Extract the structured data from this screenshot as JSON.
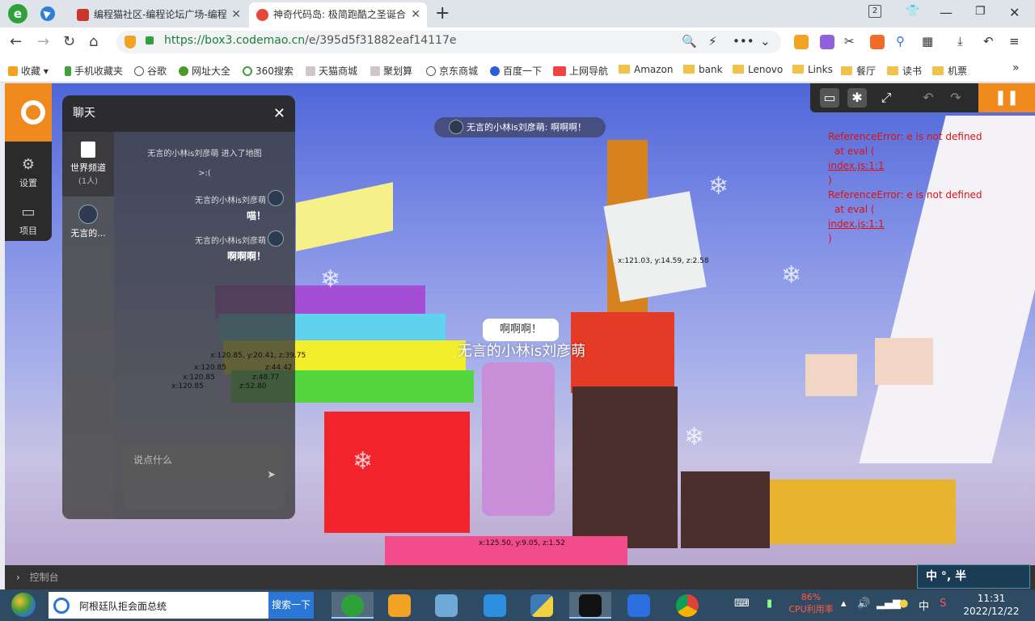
{
  "browser": {
    "brand_letter": "e",
    "tabs": [
      {
        "title": "编程猫社区-编程论坛广场-编程",
        "active": false
      },
      {
        "title": "神奇代码岛: 极简跑酷之圣诞合",
        "active": true
      }
    ],
    "window_button_count": "2",
    "url_domain": "https://box3.codemao.cn",
    "url_path": "/e/395d5f31882eaf14117e",
    "bookmarks": [
      {
        "label": "收藏",
        "kind": "star"
      },
      {
        "label": "手机收藏夹",
        "kind": "phone"
      },
      {
        "label": "谷歌",
        "kind": "globe"
      },
      {
        "label": "网址大全",
        "kind": "globe"
      },
      {
        "label": "360搜索",
        "kind": "globe"
      },
      {
        "label": "天猫商城",
        "kind": "site"
      },
      {
        "label": "聚划算",
        "kind": "site"
      },
      {
        "label": "京东商城",
        "kind": "globe"
      },
      {
        "label": "百度一下",
        "kind": "site"
      },
      {
        "label": "上网导航",
        "kind": "site"
      },
      {
        "label": "Amazon",
        "kind": "folder"
      },
      {
        "label": "bank",
        "kind": "folder"
      },
      {
        "label": "Lenovo",
        "kind": "folder"
      },
      {
        "label": "Links",
        "kind": "folder"
      },
      {
        "label": "餐厅",
        "kind": "folder"
      },
      {
        "label": "读书",
        "kind": "folder"
      },
      {
        "label": "机票",
        "kind": "folder"
      }
    ],
    "bookmarks_more": "»"
  },
  "game": {
    "rail": {
      "settings_label": "设置",
      "project_label": "项目"
    },
    "chat": {
      "title": "聊天",
      "channel_name": "世界频道",
      "channel_count": "(1人)",
      "user_short": "无言的...",
      "system_message": "无言的小林is刘彦萌 进入了地图",
      "emote": ">:(",
      "messages": [
        {
          "name": "无言的小林is刘彦萌",
          "text": "喵！"
        },
        {
          "name": "无言的小林is刘彦萌",
          "text": "啊啊啊！"
        }
      ],
      "input_placeholder": "说点什么",
      "send_glyph": "➤"
    },
    "top_bubble": "无言的小林is刘彦萌: 啊啊啊！",
    "speech": "啊啊啊！",
    "character_name": "无言的小林is刘彦萌",
    "coords": {
      "sign": "x:121.03, y:14.59, z:2.58",
      "c1": "x:120.85, y:20.41, z:39.75",
      "c2": "x:120.85",
      "c3": "x:120.85",
      "c4": "x:120.85",
      "c2b": "z:44.42",
      "c3b": "z:48.77",
      "c4b": "z:52.80",
      "player": "x:125.50, y:9.05, z:1.52"
    },
    "errors": [
      {
        "line1": "ReferenceError: e is not defined",
        "line2": "at eval (",
        "link": "index.js:1:1",
        "line4": ")"
      },
      {
        "line1": "ReferenceError: e is not defined",
        "line2": "at eval (",
        "link": "index.js:1:1",
        "line4": ")"
      }
    ],
    "console_label": "控制台",
    "ime_text": "中 °, 半"
  },
  "taskbar": {
    "search_text": "阿根廷队拒会面总统",
    "search_button": "搜索一下",
    "cpu_percent": "86%",
    "cpu_label": "CPU利用率",
    "ime_lang": "中",
    "time": "11:31",
    "date": "2022/12/22"
  },
  "colors": {
    "accent_orange": "#f08a1f",
    "error_red": "#d11111",
    "url_green": "#1a7f37"
  }
}
